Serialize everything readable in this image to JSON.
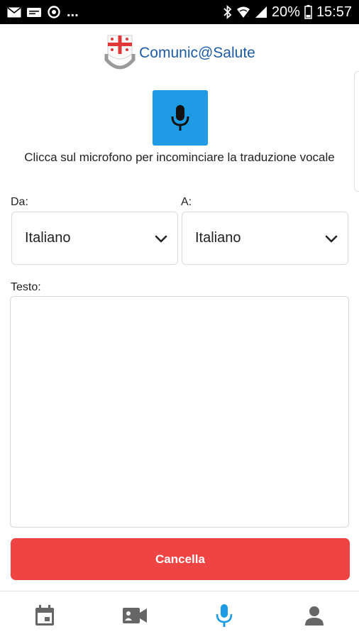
{
  "status_bar": {
    "left_icons": [
      "mail-icon",
      "card-icon",
      "sync-icon"
    ],
    "ellipsis": "...",
    "right_icons": [
      "bluetooth-icon",
      "wifi-icon",
      "signal-icon",
      "battery-icon"
    ],
    "battery": "20%",
    "time": "15:57"
  },
  "header": {
    "title": "Comunic@Salute",
    "logo": "liguria-shield-logo"
  },
  "mic": {
    "icon": "microphone-icon",
    "color": "#1e9be2",
    "instruction": "Clicca sul microfono per incominciare la traduzione vocale"
  },
  "from": {
    "label": "Da:",
    "value": "Italiano"
  },
  "to": {
    "label": "A:",
    "value": "Italiano"
  },
  "text": {
    "label": "Testo:",
    "value": ""
  },
  "cancel_button": {
    "label": "Cancella",
    "color": "#ee4444"
  },
  "bottom_nav": {
    "items": [
      {
        "icon": "calendar-icon",
        "active": false
      },
      {
        "icon": "video-camera-icon",
        "active": false
      },
      {
        "icon": "microphone-icon",
        "active": true
      },
      {
        "icon": "person-icon",
        "active": false
      }
    ],
    "active_color": "#1e9be2",
    "inactive_color": "#666666"
  }
}
